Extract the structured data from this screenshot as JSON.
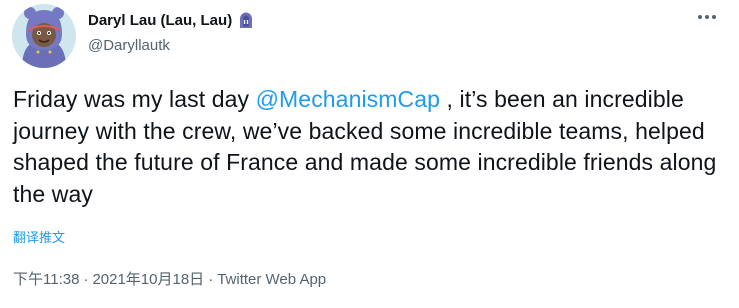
{
  "author": {
    "display_name": "Daryl Lau (Lau, Lau)",
    "handle": "@Daryllautk",
    "emoji": "hoodie-icon"
  },
  "tweet": {
    "text_before": "Friday was my last day ",
    "mention": "@MechanismCap",
    "text_after": " , it’s been an incredible journey with the crew, we’ve backed some incredible teams, helped shaped the future of France and made some incredible friends along the way",
    "translate_label": "翻译推文"
  },
  "meta": {
    "time": "下午11:38",
    "date": "2021年10月18日",
    "separator": "·",
    "source": "Twitter Web App"
  },
  "colors": {
    "accent": "#1d9bf0",
    "secondary_text": "#536471",
    "primary_text": "#0f1419",
    "avatar_bg": "#c9e3f0",
    "hoodie": "#6a6fb8"
  }
}
